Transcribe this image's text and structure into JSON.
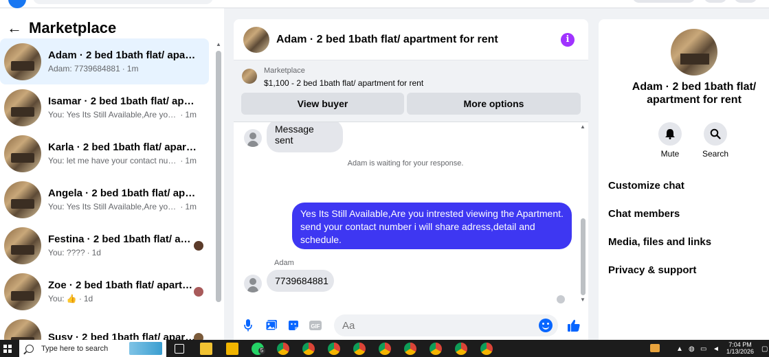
{
  "left": {
    "back_glyph": "←",
    "title": "Marketplace",
    "conversations": [
      {
        "title": "Adam · 2 bed 1bath flat/ apartm...",
        "snippet": "Adam: 7739684881",
        "time": "1m",
        "active": true
      },
      {
        "title": "Isamar · 2 bed 1bath flat/ apart...",
        "snippet": "You: Yes Its Still Available,Are you i...",
        "time": "1m"
      },
      {
        "title": "Karla · 2 bed 1bath flat/ apartme...",
        "snippet": "You: let me have your contact num...",
        "time": "1m"
      },
      {
        "title": "Angela · 2 bed 1bath flat/ apart...",
        "snippet": "You: Yes Its Still Available,Are you i...",
        "time": "1m"
      },
      {
        "title": "Festina · 2 bed 1bath flat/ apa...",
        "snippet": "You: ????",
        "time": "1d"
      },
      {
        "title": "Zoe · 2 bed 1bath flat/ apartm...",
        "snippet": "You: 👍",
        "time": "1d"
      },
      {
        "title": "Susy · 2 bed 1bath flat/ apart...",
        "snippet": "",
        "time": ""
      }
    ]
  },
  "chat": {
    "header_title": "Adam · 2 bed 1bath flat/ apartment for rent",
    "info_glyph": "i",
    "listing": {
      "label": "Marketplace",
      "price_title": "$1,100 - 2 bed 1bath flat/ apartment for rent",
      "view_buyer": "View buyer",
      "more_options": "More options"
    },
    "messages": {
      "first_in": "Message sent",
      "system": "Adam is waiting for your response.",
      "outgoing": "Yes Its Still Available,Are you intrested viewing the Apartment. send your contact number i will share adress,detail and schedule.",
      "sender_name": "Adam",
      "last_in": "7739684881"
    },
    "composer_placeholder": "Aa"
  },
  "details": {
    "title": "Adam · 2 bed 1bath flat/ apartment for rent",
    "mute_label": "Mute",
    "search_label": "Search",
    "menu": [
      "Customize chat",
      "Chat members",
      "Media, files and links",
      "Privacy & support"
    ]
  },
  "taskbar": {
    "search_text": "Type here to search",
    "whatsapp_badge": "5",
    "time": "7:04 PM",
    "date": "1/13/2026"
  },
  "colors": {
    "accent": "#0866ff",
    "outgoing_bubble": "#3e37f2",
    "info": "#a033ff",
    "active_row": "#e7f3ff"
  }
}
